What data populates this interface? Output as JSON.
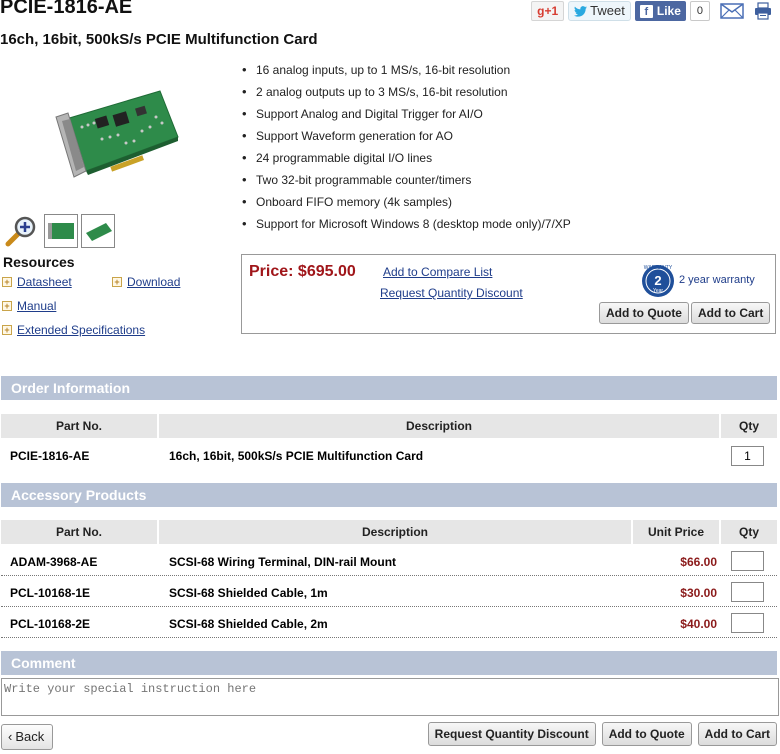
{
  "header": {
    "title": "PCIE-1816-AE",
    "subtitle": "16ch, 16bit, 500kS/s PCIE Multifunction Card"
  },
  "social": {
    "gplus_label": "+1",
    "gplus_g": "g",
    "tweet_label": "Tweet",
    "like_label": "Like",
    "like_count": "0"
  },
  "features": [
    "16 analog inputs, up to 1 MS/s, 16-bit resolution",
    "2 analog outputs up to 3 MS/s, 16-bit resolution",
    "Support Analog and Digital Trigger for AI/O",
    "Support Waveform generation for AO",
    "24 programmable digital I/O lines",
    "Two 32-bit programmable counter/timers",
    "Onboard FIFO memory (4k samples)",
    "Support for Microsoft Windows 8 (desktop mode only)/7/XP"
  ],
  "resources": {
    "title": "Resources",
    "links": [
      "Datasheet",
      "Download",
      "Manual",
      "Extended Specifications"
    ]
  },
  "price_box": {
    "price": "Price: $695.00",
    "compare_link": "Add to Compare List",
    "discount_link": "Request Quantity Discount",
    "warranty_text": "2 year warranty",
    "warranty_badge_top": "WARRANTY",
    "warranty_badge_num": "2",
    "warranty_badge_unit": "Year",
    "quote_button": "Add to Quote",
    "cart_button": "Add to Cart"
  },
  "order_info": {
    "section_title": "Order Information",
    "columns": [
      "Part No.",
      "Description",
      "Qty"
    ],
    "rows": [
      {
        "part": "PCIE-1816-AE",
        "description": "16ch, 16bit, 500kS/s PCIE Multifunction Card",
        "qty": "1"
      }
    ]
  },
  "accessories": {
    "section_title": "Accessory Products",
    "columns": [
      "Part No.",
      "Description",
      "Unit Price",
      "Qty"
    ],
    "rows": [
      {
        "part": "ADAM-3968-AE",
        "description": "SCSI-68 Wiring Terminal, DIN-rail Mount",
        "price": "$66.00",
        "qty": ""
      },
      {
        "part": "PCL-10168-1E",
        "description": "SCSI-68 Shielded Cable, 1m",
        "price": "$30.00",
        "qty": ""
      },
      {
        "part": "PCL-10168-2E",
        "description": "SCSI-68 Shielded Cable, 2m",
        "price": "$40.00",
        "qty": ""
      }
    ]
  },
  "comment": {
    "section_title": "Comment",
    "placeholder": "Write your special instruction here"
  },
  "footer": {
    "back_label": "Back",
    "discount_button": "Request Quantity Discount",
    "quote_button": "Add to Quote",
    "cart_button": "Add to Cart"
  },
  "colors": {
    "section_bar": "#b8c3d6",
    "price_red": "#a0161a",
    "link_blue": "#1f3d8a",
    "table_header": "#e6e6e6"
  }
}
